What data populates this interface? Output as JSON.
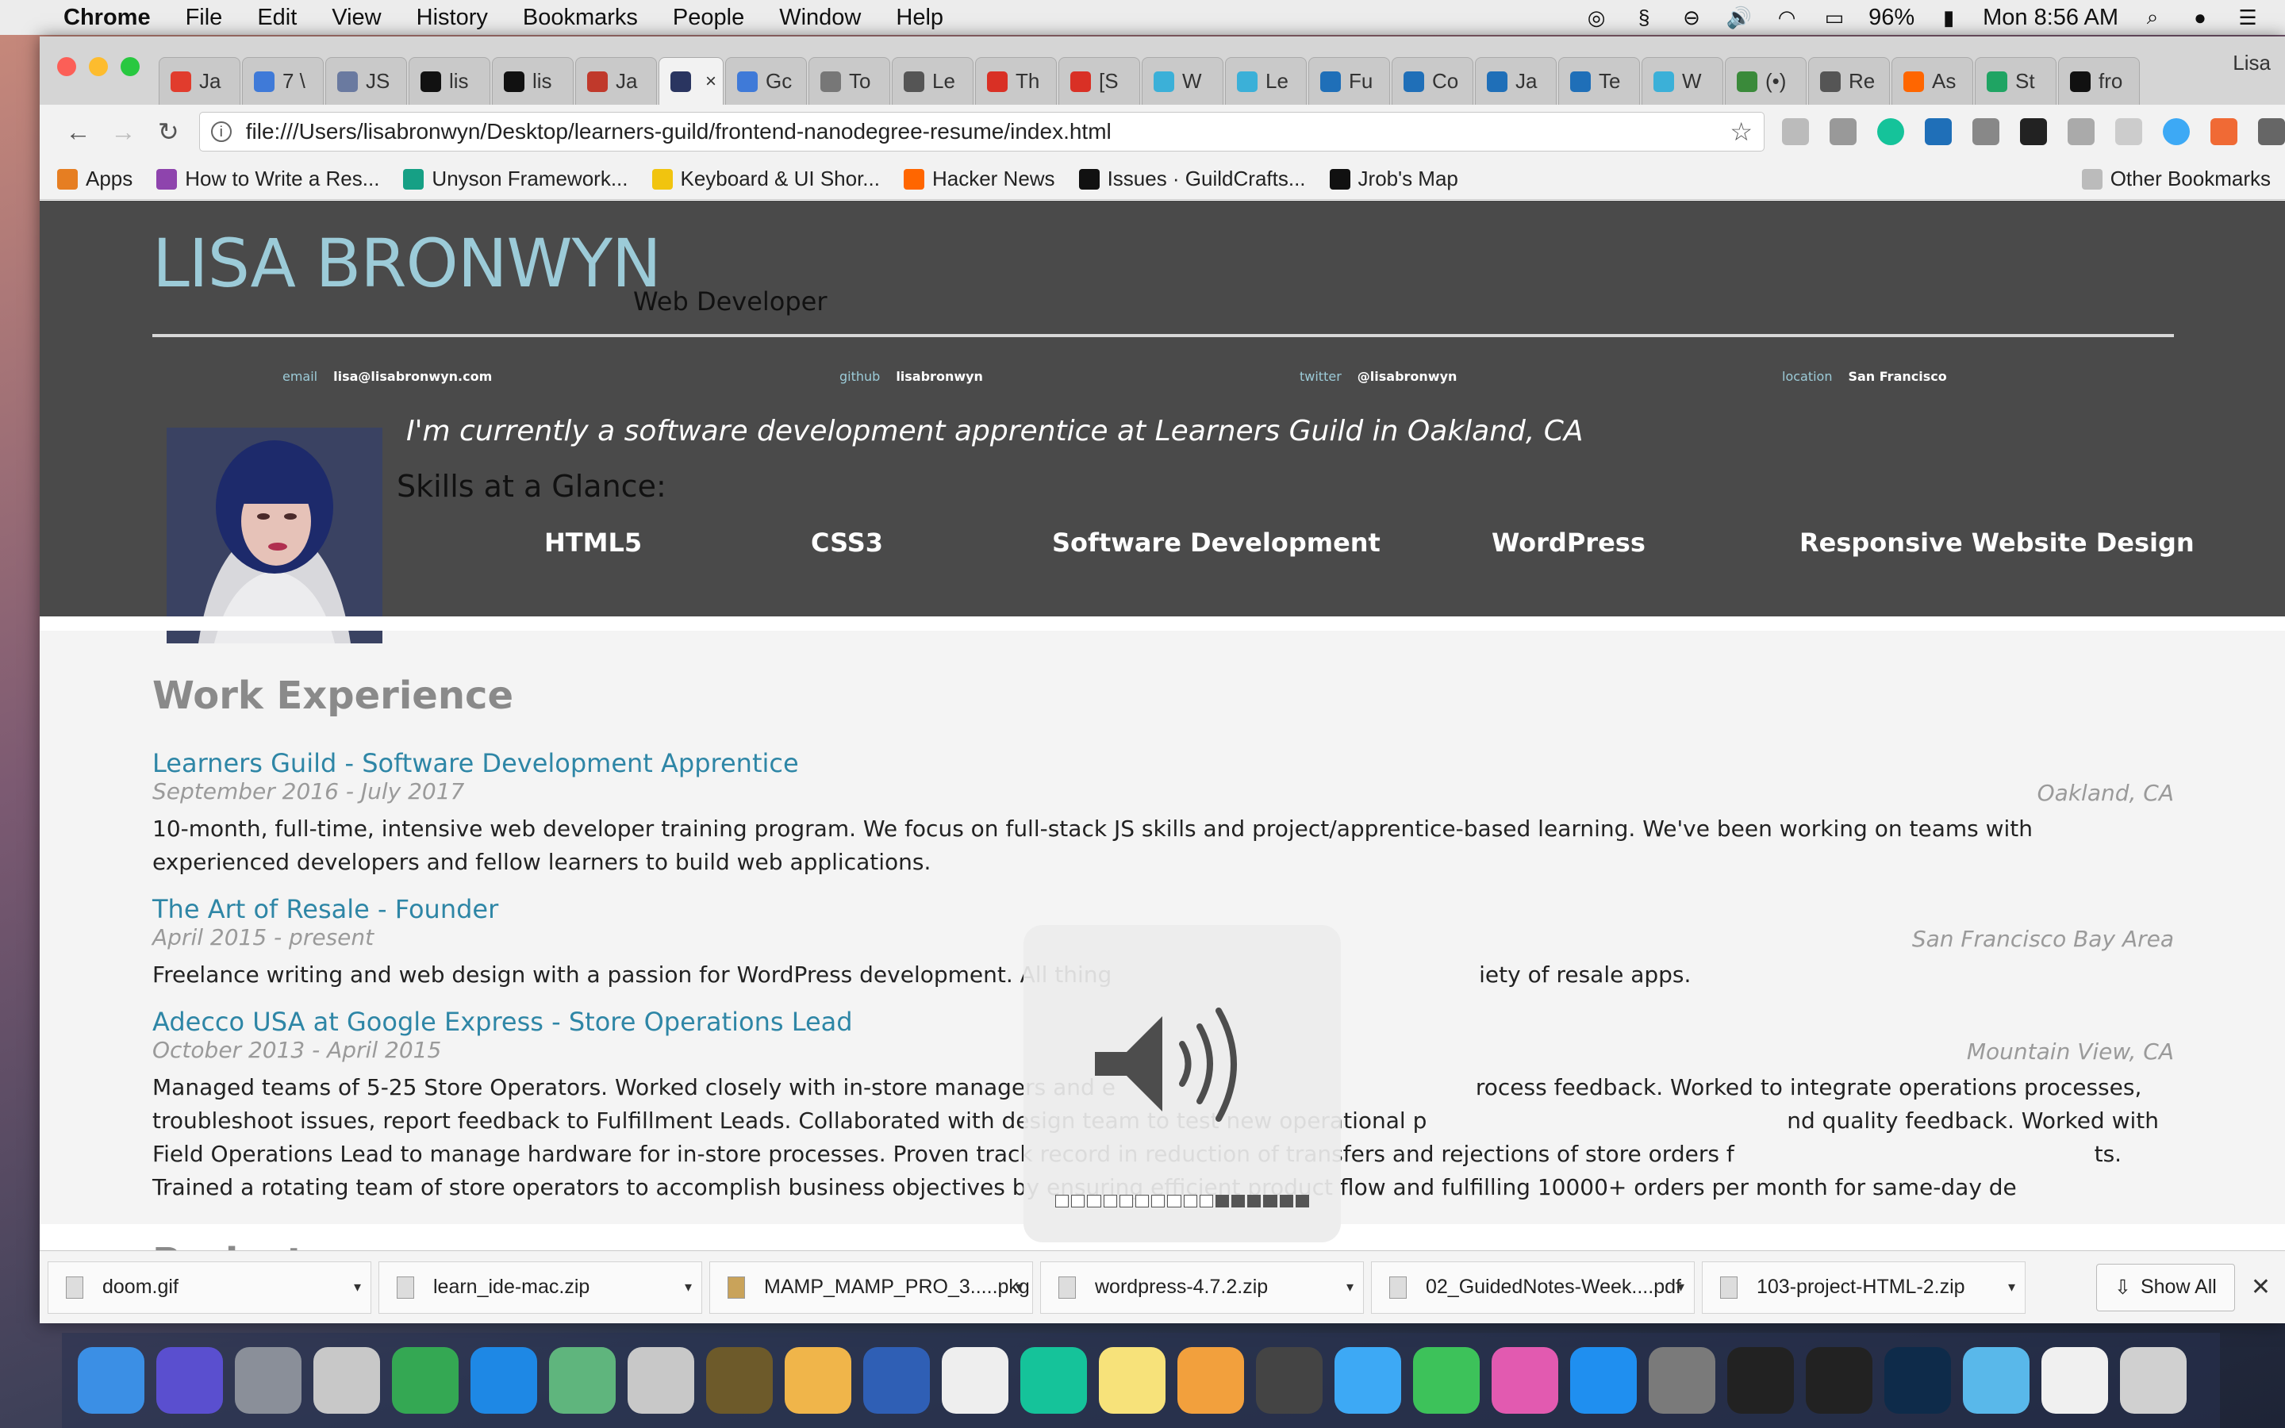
{
  "menubar": {
    "app_name": "Chrome",
    "menus": [
      "File",
      "Edit",
      "View",
      "History",
      "Bookmarks",
      "People",
      "Window",
      "Help"
    ],
    "battery": "96%",
    "clock": "Mon 8:56 AM"
  },
  "browser": {
    "tabs": [
      {
        "label": "Ja",
        "color": "#e13c2d"
      },
      {
        "label": "7 \\",
        "color": "#3f7ad8"
      },
      {
        "label": "JS",
        "color": "#6a7aa0"
      },
      {
        "label": "lis",
        "color": "#111111"
      },
      {
        "label": "lis",
        "color": "#111111"
      },
      {
        "label": "Ja",
        "color": "#c0392b"
      },
      {
        "label": "",
        "color": "#2a3560",
        "active": true
      },
      {
        "label": "Gc",
        "color": "#3f7ad8"
      },
      {
        "label": "To",
        "color": "#777777"
      },
      {
        "label": "Le",
        "color": "#555555"
      },
      {
        "label": "Th",
        "color": "#d93025"
      },
      {
        "label": "[S",
        "color": "#d93025"
      },
      {
        "label": "W",
        "color": "#3bb0d8"
      },
      {
        "label": "Le",
        "color": "#3bb0d8"
      },
      {
        "label": "Fu",
        "color": "#1f6fb8"
      },
      {
        "label": "Co",
        "color": "#1f6fb8"
      },
      {
        "label": "Ja",
        "color": "#1f6fb8"
      },
      {
        "label": "Te",
        "color": "#1f6fb8"
      },
      {
        "label": "W",
        "color": "#3bb0d8"
      },
      {
        "label": "(•)",
        "color": "#3a8a3a"
      },
      {
        "label": "Re",
        "color": "#555555"
      },
      {
        "label": "As",
        "color": "#ff6600"
      },
      {
        "label": "St",
        "color": "#1fa463"
      },
      {
        "label": "fro",
        "color": "#111111"
      }
    ],
    "profile": "Lisa",
    "url": "file:///Users/lisabronwyn/Desktop/learners-guild/frontend-nanodegree-resume/index.html",
    "bookmarks": [
      {
        "label": "Apps",
        "color": "#e67e22"
      },
      {
        "label": "How to Write a Res...",
        "color": "#8e44ad"
      },
      {
        "label": "Unyson Framework...",
        "color": "#16a085"
      },
      {
        "label": "Keyboard & UI Shor...",
        "color": "#f1c40f"
      },
      {
        "label": "Hacker News",
        "color": "#ff6600"
      },
      {
        "label": "Issues · GuildCrafts...",
        "color": "#111111"
      },
      {
        "label": "Jrob's Map",
        "color": "#111111"
      }
    ],
    "other_bookmarks": "Other Bookmarks"
  },
  "resume": {
    "name": "LISA BRONWYN",
    "role": "Web Developer",
    "contacts": [
      {
        "key": "email",
        "value": "lisa@lisabronwyn.com"
      },
      {
        "key": "github",
        "value": "lisabronwyn"
      },
      {
        "key": "twitter",
        "value": "@lisabronwyn"
      },
      {
        "key": "location",
        "value": "San Francisco"
      }
    ],
    "welcome": "I'm currently a software development apprentice at Learners Guild in Oakland, CA",
    "skills_heading": "Skills at a Glance:",
    "skills": [
      "HTML5",
      "CSS3",
      "Software Development",
      "WordPress",
      "Responsive Website Design"
    ],
    "work_heading": "Work Experience",
    "jobs": [
      {
        "title": "Learners Guild - Software Development Apprentice",
        "dates": "September 2016 - July 2017",
        "location": "Oakland, CA",
        "description": "10-month, full-time, intensive web developer training program. We focus on full-stack JS skills and project/apprentice-based learning. We've been working on teams with experienced developers and fellow learners to build web applications."
      },
      {
        "title": "The Art of Resale - Founder",
        "dates": "April 2015 - present",
        "location": "San Francisco Bay Area",
        "description": "Freelance writing and web design with a passion for WordPress development. All thing                                                    iety of resale apps."
      },
      {
        "title": "Adecco USA at Google Express - Store Operations Lead",
        "dates": "October 2013 - April 2015",
        "location": "Mountain View, CA",
        "description": "Managed teams of 5-25 Store Operators. Worked closely with in-store managers and e                                                   rocess feedback. Worked to integrate operations processes, troubleshoot issues, report feedback to Fulfillment Leads. Collaborated with design team to test new operational p                                                   nd quality feedback. Worked with Field Operations Lead to manage hardware for in-store processes. Proven track record in reduction of transfers and rejections of store orders f                                                   ts. Trained a rotating team of store operators to accomplish business objectives by ensuring efficient product flow and fulfilling 10000+ orders per month for same-day de"
      }
    ],
    "projects_heading": "Projects"
  },
  "downloads": {
    "items": [
      "doom.gif",
      "learn_ide-mac.zip",
      "MAMP_MAMP_PRO_3.....pkg",
      "wordpress-4.7.2.zip",
      "02_GuidedNotes-Week....pdf",
      "103-project-HTML-2.zip"
    ],
    "show_all": "Show All"
  },
  "volume_hud": {
    "level_fraction": 0.75,
    "segments": 16
  },
  "dock_apps": [
    {
      "name": "finder",
      "color": "#3b8fe5"
    },
    {
      "name": "siri",
      "color": "#5a4fcf"
    },
    {
      "name": "launchpad",
      "color": "#8a8f99"
    },
    {
      "name": "unknown",
      "color": "#c8c8c8"
    },
    {
      "name": "chrome",
      "color": "#34a853"
    },
    {
      "name": "safari",
      "color": "#1e88e5"
    },
    {
      "name": "atom",
      "color": "#5fb57d"
    },
    {
      "name": "unknown",
      "color": "#c8c8c8"
    },
    {
      "name": "sunglasses",
      "color": "#6d5a2a"
    },
    {
      "name": "weather",
      "color": "#f0b54a"
    },
    {
      "name": "scrum",
      "color": "#2f5fb5"
    },
    {
      "name": "scrivener",
      "color": "#eeeeee"
    },
    {
      "name": "grammarly",
      "color": "#15c39a"
    },
    {
      "name": "notes",
      "color": "#f7e27a"
    },
    {
      "name": "photos",
      "color": "#f2a03d"
    },
    {
      "name": "screenshot",
      "color": "#444444"
    },
    {
      "name": "messages",
      "color": "#3da9f5"
    },
    {
      "name": "facetime",
      "color": "#3dc25a"
    },
    {
      "name": "itunes",
      "color": "#e25ab0"
    },
    {
      "name": "app-store",
      "color": "#1f8ff0"
    },
    {
      "name": "system-preferences",
      "color": "#7a7a7a"
    },
    {
      "name": "terminal",
      "color": "#222222"
    },
    {
      "name": "terminal",
      "color": "#222222"
    },
    {
      "name": "photoshop",
      "color": "#0e2b4a"
    },
    {
      "name": "electron",
      "color": "#59b8ea"
    },
    {
      "name": "document",
      "color": "#f0f0f0"
    },
    {
      "name": "trash",
      "color": "#d0d0d0"
    }
  ]
}
